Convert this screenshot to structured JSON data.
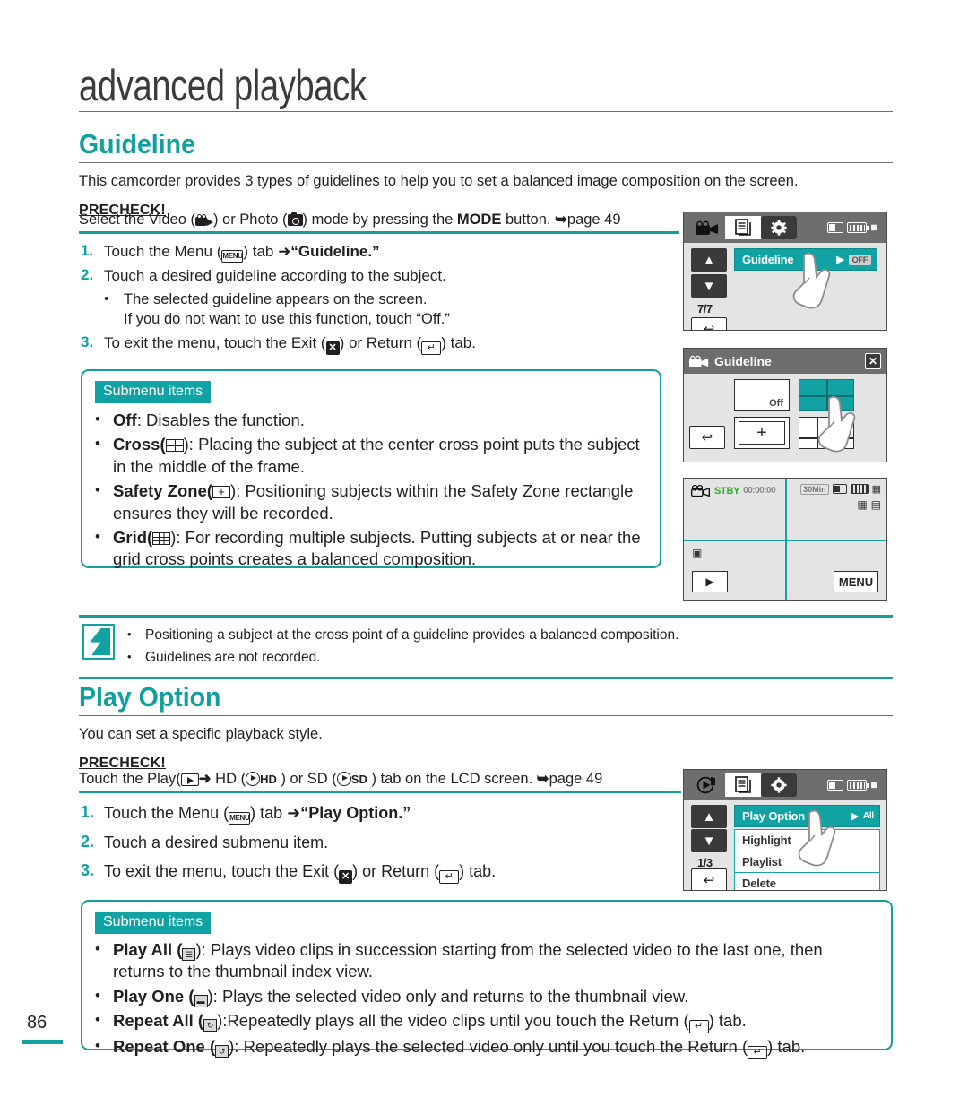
{
  "page": {
    "number": "86",
    "chapter_title": "advanced playback",
    "accent_color": "#10a0a0"
  },
  "guideline_section": {
    "heading": "Guideline",
    "intro": "This camcorder provides 3 types of guidelines to help you to set a balanced image composition on the screen.",
    "precheck_label": "PRECHECK!",
    "precheck_text_before": "Select the Video (",
    "precheck_text_mid": ") or Photo (",
    "precheck_text_after": ") mode by pressing the ",
    "precheck_bold": "MODE",
    "precheck_tail": " button. ",
    "precheck_page_ref": "page 49",
    "steps": [
      {
        "num": "1.",
        "before": "Touch the Menu (",
        "mid": ") tab ",
        "arrow": "➜",
        "bold": "“Guideline.”",
        "after": ""
      },
      {
        "num": "2.",
        "text": "Touch a desired guideline according to the subject."
      },
      {
        "num": "3.",
        "before": "To exit the menu, touch the Exit (",
        "mid": ") or Return (",
        "after": ") tab."
      }
    ],
    "sub_bullets": [
      "The selected guideline appears on the screen.",
      "If you do not want to use this function, touch “Off.”"
    ],
    "submenu_badge": "Submenu items",
    "submenu_items": [
      {
        "name": "Off",
        "icon": "none",
        "text": ": Disables the function."
      },
      {
        "name": "Cross",
        "icon": "cross-icon",
        "text": "): Placing the subject at the center cross point puts the subject in the middle of the frame."
      },
      {
        "name": "Safety Zone",
        "icon": "safety-zone-icon",
        "text": "): Positioning subjects within the Safety Zone rectangle ensures they will be recorded."
      },
      {
        "name": "Grid",
        "icon": "grid-icon",
        "text": "): For recording multiple subjects. Putting subjects at or near the grid cross points creates a balanced composition."
      }
    ]
  },
  "note_box": {
    "items": [
      "Positioning a subject at the cross point of a guideline provides a balanced composition.",
      "Guidelines are not recorded."
    ]
  },
  "play_option_section": {
    "heading": "Play Option",
    "intro": "You can set a specific playback style.",
    "precheck_label": "PRECHECK!",
    "precheck_before": "Touch the Play(",
    "precheck_hd": "HD",
    "precheck_or": ") or SD (",
    "precheck_sd": "SD",
    "precheck_after": ") tab on the LCD screen. ",
    "precheck_page_ref": "page 49",
    "steps": [
      {
        "num": "1.",
        "before": "Touch the Menu (",
        "mid": ") tab ",
        "arrow": "➜",
        "bold": "“Play Option.”"
      },
      {
        "num": "2.",
        "text": "Touch a desired submenu item."
      },
      {
        "num": "3.",
        "before": "To exit the menu, touch the Exit (",
        "mid": ") or Return (",
        "after": ") tab."
      }
    ],
    "submenu_badge": "Submenu items",
    "submenu_items": [
      {
        "name": "Play All",
        "text": "): Plays video clips in succession starting from the selected video to the last one, then returns to the thumbnail index view."
      },
      {
        "name": "Play One",
        "text": "): Plays the selected video only and returns to the thumbnail view."
      },
      {
        "name": "Repeat All",
        "text": "):Repeatedly plays all the video clips until you touch the Return ("
      },
      {
        "name": "Repeat One",
        "text": "): Repeatedly plays the selected video only until you touch the Return ("
      }
    ],
    "tab_tail": ") tab."
  },
  "lcd_menu_guideline": {
    "selected_row": "Guideline",
    "page_counter": "7/7",
    "value_badge": "OFF",
    "up_arrow": "▲",
    "down_arrow": "▼",
    "return_glyph": "↩",
    "play_glyph": "▶"
  },
  "lcd_guideline_chooser": {
    "title": "Guideline",
    "close_glyph": "✕",
    "off_label": "Off",
    "cross_plus": "+",
    "return_glyph": "↩"
  },
  "lcd_record_screen": {
    "status": "STBY",
    "timecode": "00:00:00",
    "remaining": "30Min",
    "menu_button": "MENU",
    "play_glyph": "▶"
  },
  "lcd_menu_playoption": {
    "rows": [
      "Play Option",
      "Highlight",
      "Playlist",
      "Delete"
    ],
    "page_counter": "1/3",
    "value_badge": "All",
    "up_arrow": "▲",
    "down_arrow": "▼",
    "return_glyph": "↩",
    "play_glyph": "▶"
  }
}
